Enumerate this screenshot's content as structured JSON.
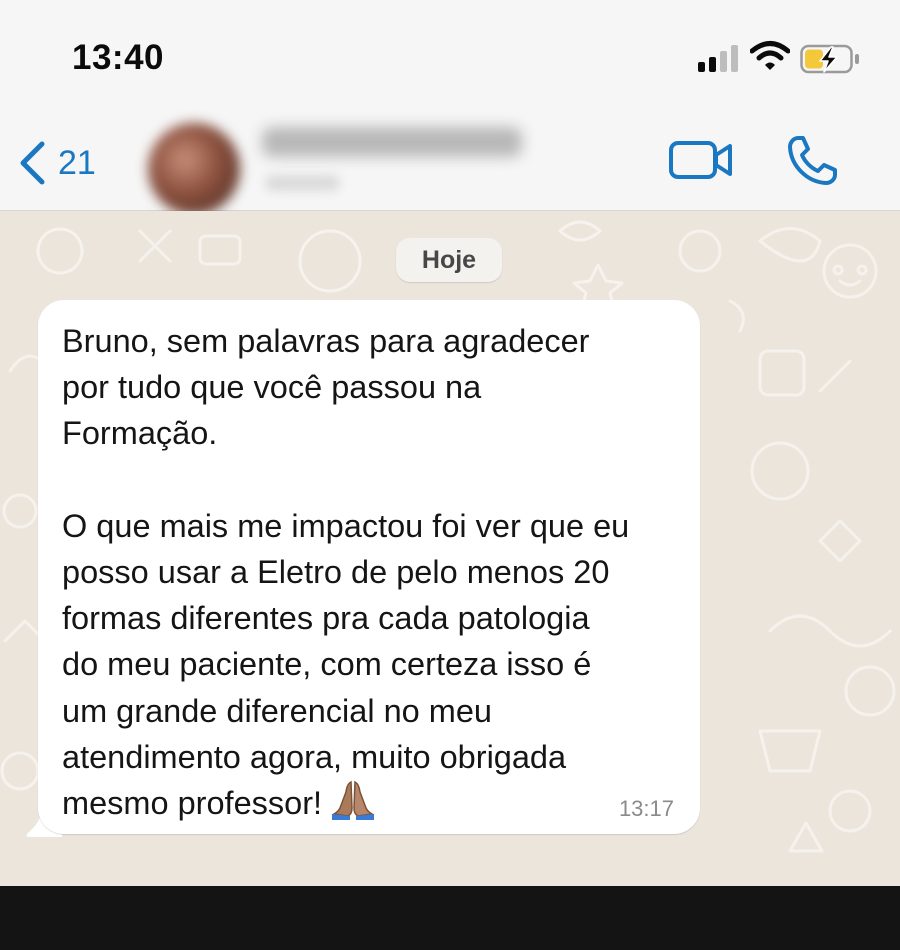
{
  "status_bar": {
    "time": "13:40"
  },
  "header": {
    "back_count": "21"
  },
  "chat": {
    "date_label": "Hoje",
    "message": {
      "text": "Bruno, sem palavras para agradecer\npor tudo que você passou na\nFormação.\n\nO que mais me impactou foi ver que eu\nposso usar a Eletro de pelo menos 20\nformas diferentes pra cada patologia\ndo meu paciente, com certeza isso é\num grande diferencial no meu\natendimento agora, muito obrigada\nmesmo professor!",
      "emoji": "folded-hands-emoji",
      "time": "13:17"
    }
  },
  "colors": {
    "accent": "#1a78c2",
    "chat_background": "#ece5dc",
    "bubble": "#ffffff",
    "battery_fill": "#f3c93b"
  }
}
